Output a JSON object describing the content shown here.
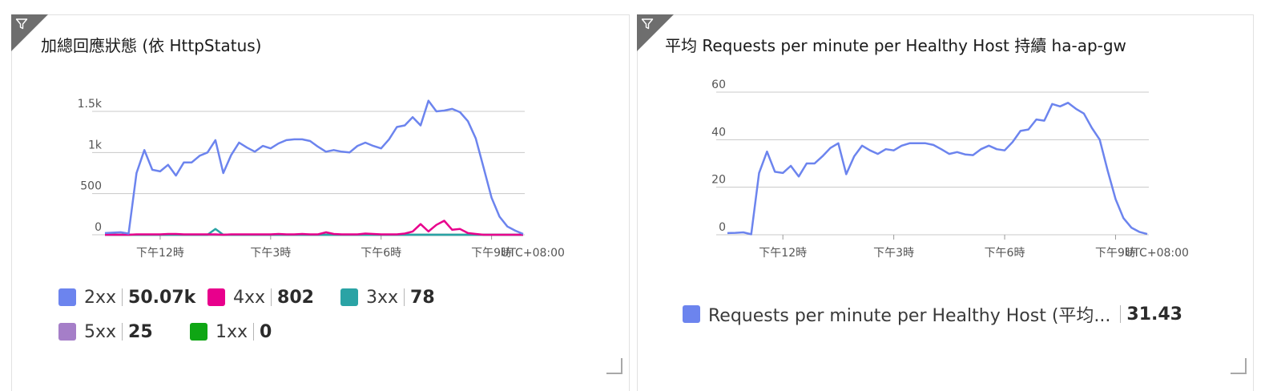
{
  "tiles": [
    {
      "title": "加總回應狀態 (依 HttpStatus)",
      "timezone": "UTC+08:00"
    },
    {
      "title": "平均 Requests per minute per Healthy Host 持續 ha-ap-gw",
      "timezone": "UTC+08:00"
    }
  ],
  "legend_left": [
    {
      "name": "2xx",
      "value": "50.07k",
      "color": "#6c84ee"
    },
    {
      "name": "4xx",
      "value": "802",
      "color": "#e8008c"
    },
    {
      "name": "3xx",
      "value": "78",
      "color": "#2aa3a5"
    },
    {
      "name": "5xx",
      "value": "25",
      "color": "#a57ec8"
    },
    {
      "name": "1xx",
      "value": "0",
      "color": "#0fa614"
    }
  ],
  "legend_right": [
    {
      "name": "Requests per minute per Healthy Host (平均...",
      "value": "31.43",
      "color": "#6c84ee"
    }
  ],
  "icons": {
    "filter": "filter-icon",
    "resize": "resize-handle-icon"
  },
  "chart_data": [
    {
      "type": "line",
      "ylim": [
        0,
        1500
      ],
      "yticks": [
        "0",
        "500",
        "1k",
        "1.5k"
      ],
      "ytick_values": [
        0,
        500,
        1000,
        1500
      ],
      "xlim": [
        0,
        63
      ],
      "xticks": [
        {
          "label": "下午12時",
          "x": 7
        },
        {
          "label": "下午3時",
          "x": 21
        },
        {
          "label": "下午6時",
          "x": 35
        },
        {
          "label": "下午9時",
          "x": 49
        }
      ],
      "grid": true,
      "series": [
        {
          "name": "2xx",
          "color": "#6c84ee",
          "values": [
            20,
            25,
            30,
            15,
            750,
            1030,
            790,
            770,
            850,
            720,
            880,
            880,
            960,
            1000,
            1150,
            750,
            970,
            1120,
            1060,
            1010,
            1080,
            1050,
            1110,
            1150,
            1160,
            1160,
            1140,
            1070,
            1010,
            1030,
            1010,
            1000,
            1080,
            1120,
            1080,
            1050,
            1160,
            1310,
            1330,
            1430,
            1330,
            1630,
            1500,
            1510,
            1530,
            1490,
            1380,
            1170,
            810,
            450,
            220,
            100,
            50,
            10
          ]
        },
        {
          "name": "4xx",
          "color": "#e8008c",
          "values": [
            0,
            0,
            0,
            0,
            5,
            5,
            5,
            5,
            10,
            10,
            5,
            5,
            5,
            5,
            5,
            0,
            5,
            5,
            5,
            5,
            5,
            5,
            10,
            5,
            5,
            10,
            5,
            5,
            30,
            10,
            5,
            5,
            5,
            15,
            10,
            5,
            5,
            5,
            15,
            40,
            130,
            40,
            120,
            170,
            60,
            70,
            20,
            10,
            0,
            0,
            0,
            0,
            0,
            0
          ]
        },
        {
          "name": "3xx",
          "color": "#2aa3a5",
          "values": [
            0,
            0,
            0,
            0,
            0,
            0,
            0,
            0,
            0,
            0,
            0,
            0,
            0,
            0,
            70,
            0,
            0,
            0,
            0,
            0,
            0,
            0,
            0,
            0,
            0,
            0,
            0,
            0,
            0,
            0,
            0,
            0,
            0,
            0,
            0,
            0,
            0,
            0,
            0,
            0,
            0,
            0,
            0,
            0,
            0,
            0,
            0,
            0,
            0,
            0,
            0,
            0,
            0,
            0
          ]
        },
        {
          "name": "5xx",
          "color": "#a57ec8",
          "values": [
            0,
            0,
            0,
            0,
            0,
            0,
            0,
            0,
            0,
            0,
            0,
            0,
            0,
            0,
            0,
            0,
            0,
            0,
            0,
            0,
            0,
            0,
            0,
            0,
            0,
            0,
            0,
            0,
            0,
            0,
            0,
            0,
            0,
            0,
            0,
            0,
            0,
            0,
            0,
            0,
            0,
            0,
            0,
            0,
            0,
            0,
            0,
            0,
            0,
            0,
            0,
            0,
            0,
            0
          ]
        },
        {
          "name": "1xx",
          "color": "#0fa614",
          "values": [
            0,
            0,
            0,
            0,
            0,
            0,
            0,
            0,
            0,
            0,
            0,
            0,
            0,
            0,
            0,
            0,
            0,
            0,
            0,
            0,
            0,
            0,
            0,
            0,
            0,
            0,
            0,
            0,
            0,
            0,
            0,
            0,
            0,
            0,
            0,
            0,
            0,
            0,
            0,
            0,
            0,
            0,
            0,
            0,
            0,
            0,
            0,
            0,
            0,
            0,
            0,
            0,
            0,
            0
          ]
        }
      ]
    },
    {
      "type": "line",
      "ylim": [
        0,
        60
      ],
      "yticks": [
        "0",
        "20",
        "40",
        "60"
      ],
      "ytick_values": [
        0,
        20,
        40,
        60
      ],
      "xlim": [
        0,
        63
      ],
      "xticks": [
        {
          "label": "下午12時",
          "x": 7
        },
        {
          "label": "下午3時",
          "x": 21
        },
        {
          "label": "下午6時",
          "x": 35
        },
        {
          "label": "下午9時",
          "x": 49
        }
      ],
      "grid": true,
      "series": [
        {
          "name": "Requests per minute per Healthy Host (平均...",
          "color": "#6c84ee",
          "values": [
            0.7,
            0.8,
            1,
            0.2,
            26,
            35,
            26.5,
            26,
            29,
            24.5,
            30,
            30,
            33,
            36.5,
            38.5,
            25.5,
            33,
            37.5,
            35.5,
            34,
            36,
            35.5,
            37.5,
            38.5,
            38.5,
            38.5,
            37.8,
            36,
            34,
            34.8,
            33.8,
            33.5,
            36,
            37.5,
            36,
            35.5,
            39,
            43.7,
            44.3,
            48.5,
            48,
            55,
            54,
            55.5,
            53,
            51,
            45,
            40,
            27,
            15,
            7,
            3,
            1.2,
            0.3
          ]
        }
      ]
    }
  ]
}
